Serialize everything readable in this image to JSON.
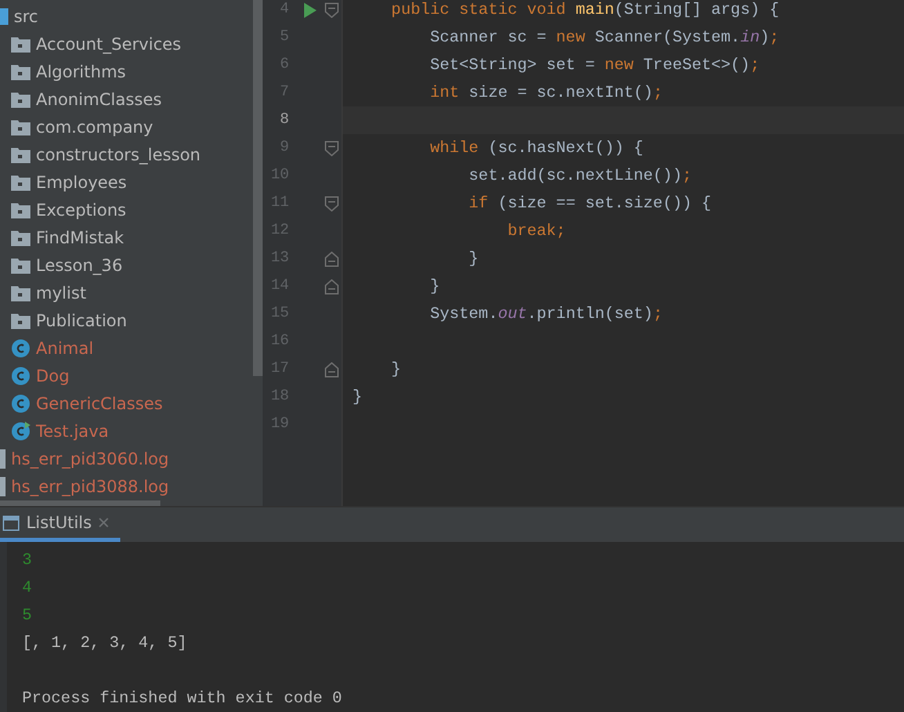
{
  "project_tree": {
    "items": [
      {
        "label": "src",
        "kind": "source_root",
        "unversioned": false,
        "children": [
          {
            "label": "Account_Services",
            "kind": "package",
            "unversioned": false
          },
          {
            "label": "Algorithms",
            "kind": "package",
            "unversioned": false
          },
          {
            "label": "AnonimClasses",
            "kind": "package",
            "unversioned": false
          },
          {
            "label": "com.company",
            "kind": "package",
            "unversioned": false
          },
          {
            "label": "constructors_lesson",
            "kind": "package",
            "unversioned": false
          },
          {
            "label": "Employees",
            "kind": "package",
            "unversioned": false
          },
          {
            "label": "Exceptions",
            "kind": "package",
            "unversioned": false
          },
          {
            "label": "FindMistak",
            "kind": "package",
            "unversioned": false
          },
          {
            "label": "Lesson_36",
            "kind": "package",
            "unversioned": false
          },
          {
            "label": "mylist",
            "kind": "package",
            "unversioned": false
          },
          {
            "label": "Publication",
            "kind": "package",
            "unversioned": false
          },
          {
            "label": "Animal",
            "kind": "class",
            "unversioned": true
          },
          {
            "label": "Dog",
            "kind": "class",
            "unversioned": true
          },
          {
            "label": "GenericClasses",
            "kind": "class",
            "unversioned": true
          },
          {
            "label": "Test.java",
            "kind": "runnable_class",
            "unversioned": true
          }
        ]
      },
      {
        "label": "hs_err_pid3060.log",
        "kind": "file",
        "unversioned": true
      },
      {
        "label": "hs_err_pid3088.log",
        "kind": "file",
        "unversioned": true
      }
    ]
  },
  "editor": {
    "lines": [
      {
        "number": "4",
        "run": true,
        "fold_start": true,
        "fold_end": false,
        "current": false,
        "tokens": [
          {
            "text": "    public static void ",
            "kind": "keyword"
          },
          {
            "text": "main",
            "kind": "method"
          },
          {
            "text": "(String[] args) {",
            "kind": "plain"
          }
        ]
      },
      {
        "number": "5",
        "run": false,
        "fold_start": false,
        "fold_end": false,
        "current": false,
        "tokens": [
          {
            "text": "        Scanner sc = ",
            "kind": "plain"
          },
          {
            "text": "new ",
            "kind": "keyword"
          },
          {
            "text": "Scanner(System.",
            "kind": "plain"
          },
          {
            "text": "in",
            "kind": "field"
          },
          {
            "text": ")",
            "kind": "plain"
          },
          {
            "text": ";",
            "kind": "keyword"
          }
        ]
      },
      {
        "number": "6",
        "run": false,
        "fold_start": false,
        "fold_end": false,
        "current": false,
        "tokens": [
          {
            "text": "        Set<String> set = ",
            "kind": "plain"
          },
          {
            "text": "new ",
            "kind": "keyword"
          },
          {
            "text": "TreeSet<>()",
            "kind": "plain"
          },
          {
            "text": ";",
            "kind": "keyword"
          }
        ]
      },
      {
        "number": "7",
        "run": false,
        "fold_start": false,
        "fold_end": false,
        "current": false,
        "tokens": [
          {
            "text": "        int ",
            "kind": "keyword"
          },
          {
            "text": "size = sc.nextInt()",
            "kind": "plain"
          },
          {
            "text": ";",
            "kind": "keyword"
          }
        ]
      },
      {
        "number": "8",
        "run": false,
        "fold_start": false,
        "fold_end": false,
        "current": true
      },
      {
        "number": "9",
        "run": false,
        "fold_start": true,
        "fold_end": false,
        "current": false,
        "tokens": [
          {
            "text": "        while ",
            "kind": "keyword"
          },
          {
            "text": "(sc.hasNext()) {",
            "kind": "plain"
          }
        ]
      },
      {
        "number": "10",
        "run": false,
        "fold_start": false,
        "fold_end": false,
        "current": false,
        "tokens": [
          {
            "text": "            set.add(sc.nextLine())",
            "kind": "plain"
          },
          {
            "text": ";",
            "kind": "keyword"
          }
        ]
      },
      {
        "number": "11",
        "run": false,
        "fold_start": true,
        "fold_end": false,
        "current": false,
        "tokens": [
          {
            "text": "            if ",
            "kind": "keyword"
          },
          {
            "text": "(size == set.size()) {",
            "kind": "plain"
          }
        ]
      },
      {
        "number": "12",
        "run": false,
        "fold_start": false,
        "fold_end": false,
        "current": false,
        "tokens": [
          {
            "text": "                break;",
            "kind": "keyword"
          }
        ]
      },
      {
        "number": "13",
        "run": false,
        "fold_start": false,
        "fold_end": true,
        "current": false,
        "tokens": [
          {
            "text": "            }",
            "kind": "plain"
          }
        ]
      },
      {
        "number": "14",
        "run": false,
        "fold_start": false,
        "fold_end": true,
        "current": false,
        "tokens": [
          {
            "text": "        }",
            "kind": "plain"
          }
        ]
      },
      {
        "number": "15",
        "run": false,
        "fold_start": false,
        "fold_end": false,
        "current": false,
        "tokens": [
          {
            "text": "        System.",
            "kind": "plain"
          },
          {
            "text": "out",
            "kind": "field"
          },
          {
            "text": ".println(set)",
            "kind": "plain"
          },
          {
            "text": ";",
            "kind": "keyword"
          }
        ]
      },
      {
        "number": "16",
        "run": false,
        "fold_start": false,
        "fold_end": false,
        "current": false
      },
      {
        "number": "17",
        "run": false,
        "fold_start": false,
        "fold_end": true,
        "current": false,
        "tokens": [
          {
            "text": "    }",
            "kind": "plain"
          }
        ]
      },
      {
        "number": "18",
        "run": false,
        "fold_start": false,
        "fold_end": false,
        "current": false,
        "tokens": [
          {
            "text": "}",
            "kind": "plain"
          }
        ]
      },
      {
        "number": "19",
        "run": false,
        "fold_start": false,
        "fold_end": false,
        "current": false
      }
    ]
  },
  "run_panel": {
    "tabs": [
      {
        "label": "ListUtils",
        "selected": true
      }
    ],
    "console": [
      {
        "text": "3",
        "kind": "input"
      },
      {
        "text": "4",
        "kind": "input"
      },
      {
        "text": "5",
        "kind": "input"
      },
      {
        "text": "[, 1, 2, 3, 4, 5]",
        "kind": "output"
      },
      {
        "kind": "blank"
      },
      {
        "text": "Process finished with exit code 0",
        "kind": "output"
      }
    ]
  }
}
